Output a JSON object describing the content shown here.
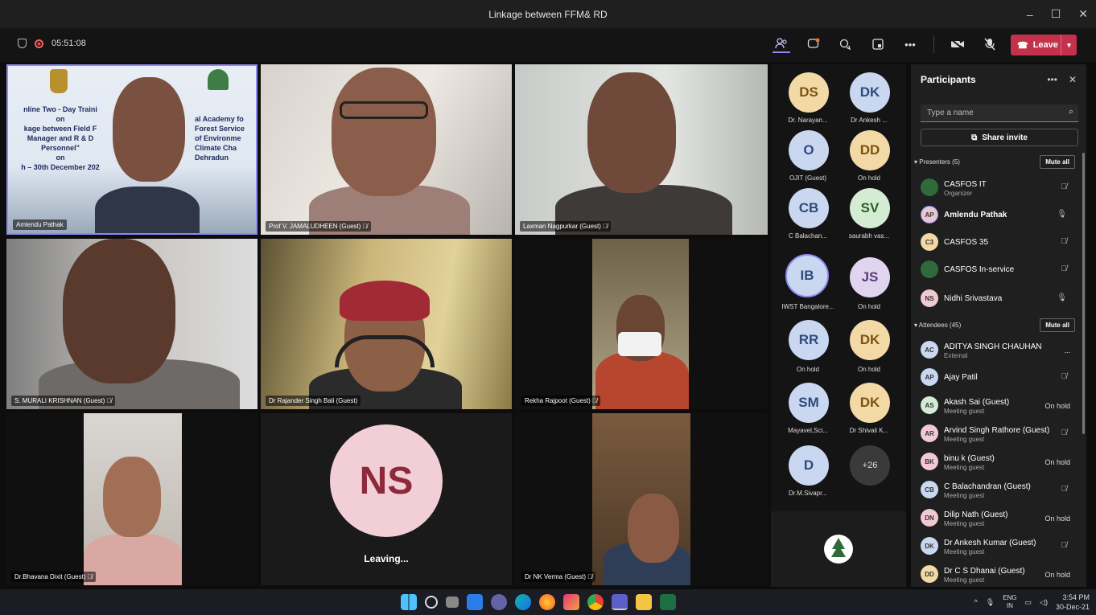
{
  "window": {
    "title": "Linkage between FFM& RD",
    "controls": [
      "–",
      "☐",
      "✕"
    ]
  },
  "meeting": {
    "timer": "05:51:08",
    "leave_label": "Leave"
  },
  "toolbar": {
    "icons": [
      "people-icon",
      "chat-icon",
      "reactions-icon",
      "rooms-icon",
      "more-icon",
      "camera-off-icon",
      "mic-off-icon",
      "share-icon"
    ]
  },
  "slide": {
    "lines": [
      "nline Two - Day Traini",
      "on",
      "kage between Field F",
      "Manager and R & D",
      "Personnel\"",
      "on",
      "h – 30th  December 202"
    ],
    "right_lines": [
      "al Academy fo",
      "Forest Service",
      "of Environme",
      "Climate Cha",
      "Dehradun"
    ]
  },
  "tiles": [
    {
      "name": "Amlendu Pathak",
      "muted": false
    },
    {
      "name": "Prof V. JAMALUDHEEN (Guest)",
      "muted": true
    },
    {
      "name": "Laxman Nagpurkar (Guest)",
      "muted": true
    },
    {
      "name": "S. MURALI KRISHNAN (Guest)",
      "muted": true
    },
    {
      "name": "Dr Rajander Singh Bali (Guest)",
      "muted": false
    },
    {
      "name": "Rekha Rajpoot (Guest)",
      "muted": true
    },
    {
      "name": "Dr.Bhavana Dixit (Guest)",
      "muted": true
    },
    {
      "name": "Leaving...",
      "initials": "NS"
    },
    {
      "name": "Dr NK Verma (Guest)",
      "muted": true
    }
  ],
  "roster": [
    {
      "initials": "DS",
      "label": "Dr. Narayan...",
      "color": "#f3d9a6",
      "muted": true
    },
    {
      "initials": "DK",
      "label": "Dr Ankesh ...",
      "color": "#c9d7f0",
      "muted": true
    },
    {
      "initials": "O",
      "label": "OJIT (Guest)",
      "color": "#c9d7f0",
      "muted": true
    },
    {
      "initials": "DD",
      "label": "On hold",
      "color": "#f3d9a6",
      "muted": false
    },
    {
      "initials": "CB",
      "label": "C Balachan...",
      "color": "#c9d7f0",
      "muted": true
    },
    {
      "initials": "SV",
      "label": "saurabh vas...",
      "color": "#d4ecd4",
      "muted": true
    },
    {
      "initials": "IB",
      "label": "IWST Bangalore...",
      "color": "#c9d7f0",
      "muted": false
    },
    {
      "initials": "JS",
      "label": "On hold",
      "color": "#e0d4ee",
      "muted": false
    },
    {
      "initials": "RR",
      "label": "On hold",
      "color": "#c9d7f0",
      "muted": false
    },
    {
      "initials": "DK",
      "label": "On hold",
      "color": "#f3d9a6",
      "muted": false
    },
    {
      "initials": "SM",
      "label": "Mayavel,Sci...",
      "color": "#c9d7f0",
      "muted": true
    },
    {
      "initials": "DK",
      "label": "Dr Shivali K...",
      "color": "#f3d9a6",
      "muted": true
    },
    {
      "initials": "D",
      "label": "Dr.M.Sivapr...",
      "color": "#c9d7f0",
      "muted": true
    },
    {
      "initials": "+26",
      "label": "",
      "color": "#3a3a3a",
      "muted": false
    }
  ],
  "panel": {
    "title": "Participants",
    "search_placeholder": "Type a name",
    "share_invite": "Share invite",
    "presenters_label": "Presenters (5)",
    "attendees_label": "Attendees (45)",
    "mute_all": "Mute all",
    "presenters": [
      {
        "initials": "",
        "name": "CASFOS IT",
        "sub": "Organizer",
        "status": "",
        "mic": "off",
        "avatar": "#2f6b3a"
      },
      {
        "initials": "AP",
        "name": "Amlendu Pathak",
        "sub": "",
        "status": "",
        "mic": "on",
        "avatar": "#e8c6d3"
      },
      {
        "initials": "C3",
        "name": "CASFOS 35",
        "sub": "",
        "status": "",
        "mic": "off",
        "avatar": "#f3d9a6"
      },
      {
        "initials": "",
        "name": "CASFOS In-service",
        "sub": "",
        "status": "",
        "mic": "off",
        "avatar": "#2f6b3a"
      },
      {
        "initials": "NS",
        "name": "Nidhi Srivastava",
        "sub": "",
        "status": "",
        "mic": "on",
        "avatar": "#f0c9d2"
      }
    ],
    "attendees": [
      {
        "initials": "AC",
        "name": "ADITYA SINGH CHAUHAN",
        "sub": "External",
        "status": "...",
        "mic": "",
        "avatar": "#c9d7f0"
      },
      {
        "initials": "AP",
        "name": "Ajay Patil",
        "sub": "",
        "status": "",
        "mic": "off",
        "avatar": "#c9d7f0"
      },
      {
        "initials": "AS",
        "name": "Akash Sai (Guest)",
        "sub": "Meeting guest",
        "status": "On hold",
        "mic": "",
        "avatar": "#d4ecd4"
      },
      {
        "initials": "AR",
        "name": "Arvind Singh Rathore (Guest)",
        "sub": "Meeting guest",
        "status": "",
        "mic": "off",
        "avatar": "#f0c9d2"
      },
      {
        "initials": "BK",
        "name": "binu k (Guest)",
        "sub": "Meeting guest",
        "status": "On hold",
        "mic": "",
        "avatar": "#f0c9d2"
      },
      {
        "initials": "CB",
        "name": "C Balachandran (Guest)",
        "sub": "Meeting guest",
        "status": "",
        "mic": "off",
        "avatar": "#c9d7f0"
      },
      {
        "initials": "DN",
        "name": "Dilip Nath (Guest)",
        "sub": "Meeting guest",
        "status": "On hold",
        "mic": "",
        "avatar": "#f0c9d2"
      },
      {
        "initials": "DK",
        "name": "Dr Ankesh Kumar (Guest)",
        "sub": "Meeting guest",
        "status": "",
        "mic": "off",
        "avatar": "#c9d7f0"
      },
      {
        "initials": "DD",
        "name": "Dr C S Dhanai (Guest)",
        "sub": "Meeting guest",
        "status": "On hold",
        "mic": "",
        "avatar": "#f3d9a6"
      }
    ]
  },
  "taskbar": {
    "apps": [
      "start-icon",
      "search-icon",
      "task-view-icon",
      "widgets-icon",
      "chat-app-icon",
      "edge-icon",
      "firefox-icon",
      "photos-icon",
      "chrome-icon",
      "teams-icon",
      "file-explorer-icon",
      "excel-icon"
    ],
    "lang": "ENG",
    "region": "IN",
    "time": "3:54 PM",
    "date": "30-Dec-21"
  }
}
